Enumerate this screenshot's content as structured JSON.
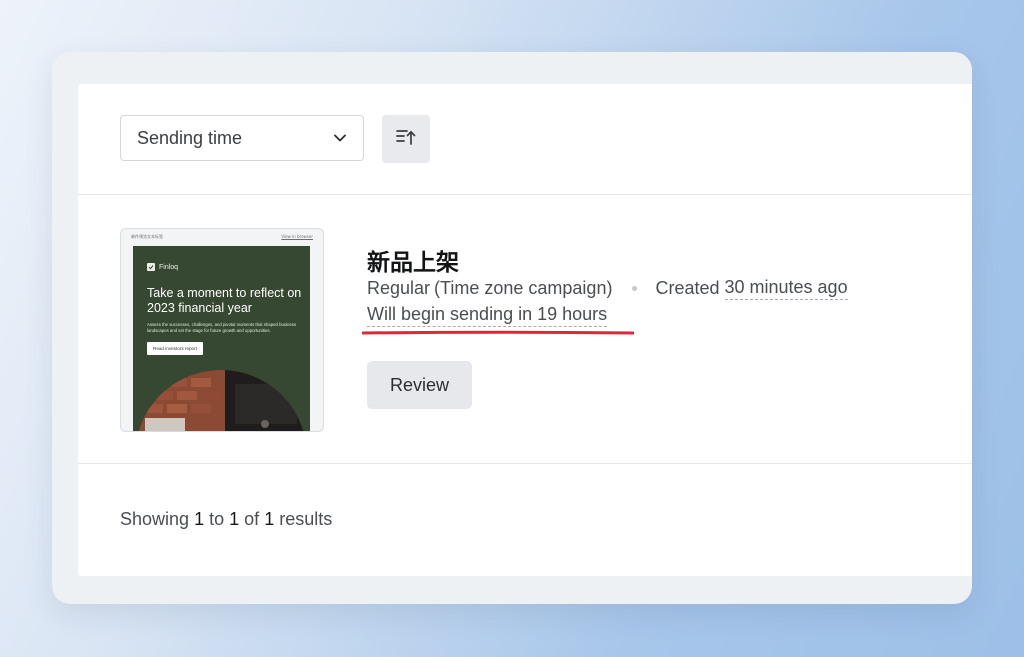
{
  "toolbar": {
    "sort_select": {
      "selected": "Sending time",
      "icon": "chevron-down-icon"
    },
    "sort_direction_icon": "sort-ascending-icon"
  },
  "campaign": {
    "title": "新品上架",
    "type": "Regular",
    "subtype": "(Time zone campaign)",
    "created_label": "Created",
    "created_relative": "30 minutes ago",
    "schedule": "Will begin sending in 19 hours",
    "review_label": "Review",
    "annotation_color": "#e3243b",
    "thumbnail": {
      "header_text": "邮件预览文本标签",
      "header_link": "View in browser",
      "brand": "Finloq",
      "headline": "Take a moment to reflect on 2023 financial year",
      "body": "Assess the successes, challenges, and pivotal moments that shaped business landscapes and set the stage for future growth and opportunities.",
      "cta": "Read investors report",
      "card_color": "#364832"
    }
  },
  "pagination": {
    "prefix": "Showing",
    "from": "1",
    "to_word": "to",
    "to": "1",
    "of_word": "of",
    "total": "1",
    "suffix": "results"
  }
}
